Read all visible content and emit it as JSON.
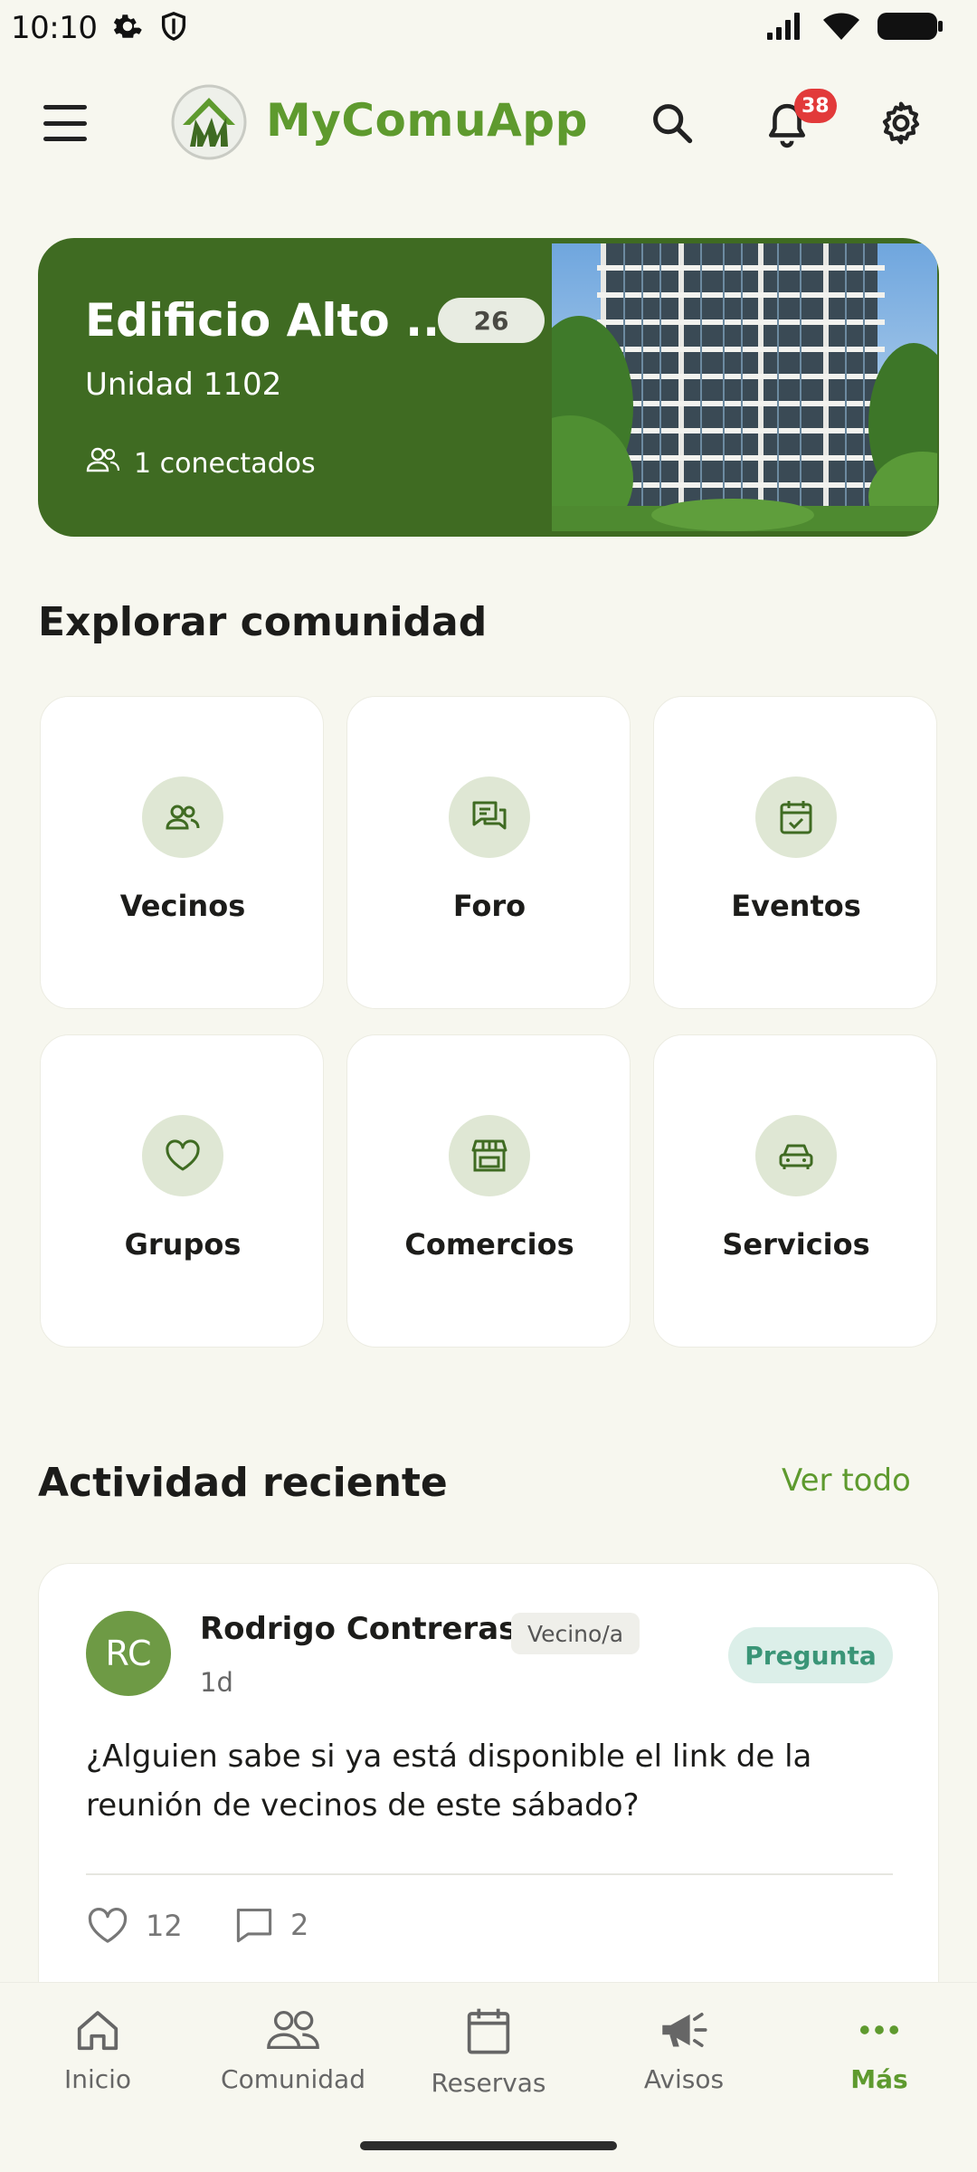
{
  "status_bar": {
    "time": "10:10"
  },
  "app_bar": {
    "title": "MyComuApp",
    "notification_count": "38"
  },
  "building": {
    "name": "Edificio Alto ...",
    "count": "26",
    "unit": "Unidad 1102",
    "connected": "1 conectados"
  },
  "explore": {
    "title": "Explorar comunidad",
    "items": [
      {
        "label": "Vecinos",
        "icon": "people-icon"
      },
      {
        "label": "Foro",
        "icon": "forum-icon"
      },
      {
        "label": "Eventos",
        "icon": "calendar-check-icon"
      },
      {
        "label": "Grupos",
        "icon": "heart-icon"
      },
      {
        "label": "Comercios",
        "icon": "store-icon"
      },
      {
        "label": "Servicios",
        "icon": "car-icon"
      }
    ]
  },
  "activity": {
    "title": "Actividad reciente",
    "see_all": "Ver todo",
    "post": {
      "initials": "RC",
      "author": "Rodrigo Contreras",
      "role": "Vecino/a",
      "time": "1d",
      "type": "Pregunta",
      "body": "¿Alguien sabe si ya está disponible el link de la reunión de vecinos de este sábado?",
      "likes": "12",
      "comments": "2"
    }
  },
  "bottom_nav": [
    {
      "label": "Inicio",
      "icon": "home-icon"
    },
    {
      "label": "Comunidad",
      "icon": "community-icon"
    },
    {
      "label": "Reservas",
      "icon": "calendar-icon"
    },
    {
      "label": "Avisos",
      "icon": "megaphone-icon"
    },
    {
      "label": "Más",
      "icon": "more-icon"
    }
  ],
  "colors": {
    "brand": "#5e9a2e",
    "card_green": "#3f6b22",
    "background": "#f7f7ef",
    "badge": "#e23a3a",
    "question": "#3a9577"
  }
}
